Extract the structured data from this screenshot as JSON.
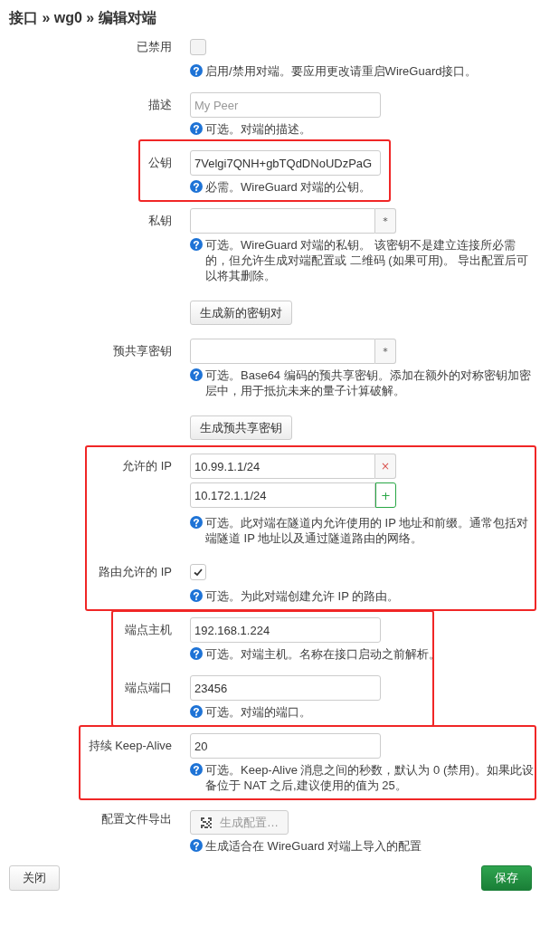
{
  "title": "接口 » wg0 » 编辑对端",
  "groups": [
    {
      "highlighted": false,
      "rows": [
        {
          "kind": "checkbox",
          "label": "已禁用",
          "checked": false,
          "help": "启用/禁用对端。要应用更改请重启WireGuard接口。"
        },
        {
          "kind": "text",
          "label": "描述",
          "placeholder": "My Peer",
          "help": "可选。对端的描述。"
        }
      ]
    },
    {
      "highlighted": true,
      "rows": [
        {
          "kind": "text",
          "label": "公钥",
          "value": "7Velgi7QNH+gbTQdDNoUDzPaG",
          "help": "必需。WireGuard 对端的公钥。"
        }
      ]
    },
    {
      "highlighted": false,
      "rows": [
        {
          "kind": "secret",
          "label": "私钥",
          "reveal": "*",
          "help": "可选。WireGuard 对端的私钥。 该密钥不是建立连接所必需的，但允许生成对端配置或 二维码 (如果可用)。 导出配置后可以将其删除。"
        },
        {
          "kind": "button",
          "text": "生成新的密钥对"
        },
        {
          "kind": "secret",
          "label": "预共享密钥",
          "reveal": "*",
          "help": "可选。Base64 编码的预共享密钥。添加在额外的对称密钥加密层中，用于抵抗未来的量子计算破解。"
        },
        {
          "kind": "button",
          "text": "生成预共享密钥"
        }
      ]
    },
    {
      "highlighted": true,
      "rows": [
        {
          "kind": "list",
          "label": "允许的 IP",
          "items": [
            {
              "value": "10.99.1.1/24",
              "kind": "remove",
              "action": "×"
            },
            {
              "value": "10.172.1.1/24",
              "kind": "add",
              "action": "+"
            }
          ],
          "help": "可选。此对端在隧道内允许使用的 IP 地址和前缀。通常包括对端隧道 IP 地址以及通过隧道路由的网络。"
        },
        {
          "kind": "checkbox",
          "label": "路由允许的 IP",
          "checked": true,
          "help": "可选。为此对端创建允许 IP 的路由。"
        }
      ]
    },
    {
      "highlighted": true,
      "rows": [
        {
          "kind": "text",
          "label": "端点主机",
          "value": "192.168.1.224",
          "help": "可选。对端主机。名称在接口启动之前解析。"
        },
        {
          "kind": "text",
          "label": "端点端口",
          "value": "23456",
          "help": "可选。对端的端口。"
        }
      ]
    },
    {
      "highlighted": true,
      "rows": [
        {
          "kind": "text",
          "label": "持续 Keep-Alive",
          "value": "20",
          "help": "可选。Keep-Alive 消息之间的秒数，默认为 0 (禁用)。如果此设备位于 NAT 之后,建议使用的值为 25。"
        }
      ]
    },
    {
      "highlighted": false,
      "rows": [
        {
          "kind": "export",
          "label": "配置文件导出",
          "text": "生成配置…",
          "disabled": true,
          "help": "生成适合在 WireGuard 对端上导入的配置"
        }
      ]
    }
  ],
  "footer": [
    {
      "text": "关闭",
      "kind": "default"
    },
    {
      "text": "保存",
      "kind": "primary"
    }
  ]
}
